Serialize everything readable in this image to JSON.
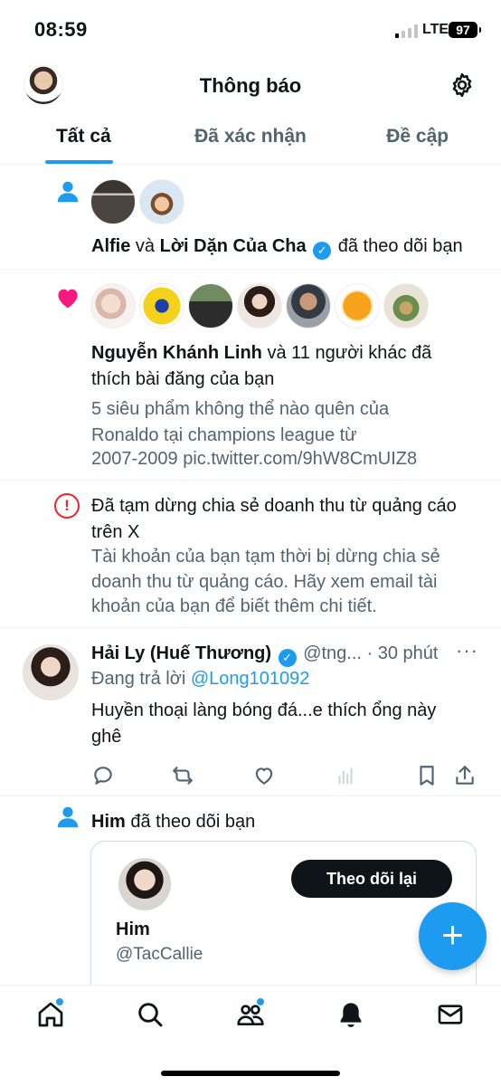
{
  "status_bar": {
    "time": "08:59",
    "network": "LTE",
    "battery": "97"
  },
  "header": {
    "title": "Thông báo"
  },
  "tabs": [
    {
      "label": "Tất cả",
      "active": true
    },
    {
      "label": "Đã xác nhận",
      "active": false
    },
    {
      "label": "Đề cập",
      "active": false
    }
  ],
  "notifications": {
    "follow1": {
      "name1": "Alfie",
      "joiner": "và",
      "name2": "Lời Dặn Của Cha",
      "action": "đã theo dõi bạn"
    },
    "likes": {
      "name": "Nguyễn Khánh Linh",
      "action": "và 11 người khác đã thích bài đăng của bạn",
      "post_line1": "5 siêu phẩm không thể nào quên của",
      "post_line2": "Ronaldo tại champions league từ",
      "post_line3": "2007-2009 pic.twitter.com/9hW8CmUIZ8"
    },
    "alert": {
      "title_line1": "Đã tạm dừng chia sẻ doanh thu từ quảng cáo",
      "title_line2": "trên X",
      "body_line1": "Tài khoản của bạn tạm thời bị dừng chia sẻ",
      "body_line2": "doanh thu từ quảng cáo. Hãy xem email tài",
      "body_line3": "khoản của bạn để biết thêm chi tiết."
    },
    "reply": {
      "author": "Hải Ly (Huế Thương)",
      "handle": "@tng...",
      "time": "· 30 phút",
      "replying_label": "Đang trả lời",
      "replying_to": "@Long101092",
      "text_line1": "Huyền thoại làng bóng đá...e thích ổng này",
      "text_line2": "ghê",
      "more": "···"
    },
    "follow2": {
      "name": "Him",
      "action": "đã theo dõi bạn",
      "card": {
        "name": "Him",
        "handle": "@TacCallie",
        "button": "Theo dõi lại"
      }
    }
  },
  "fab": {
    "label": "+"
  },
  "icons": {
    "accent": "#1d9bf0",
    "like": "#f91880",
    "alert": "#f4212e"
  }
}
